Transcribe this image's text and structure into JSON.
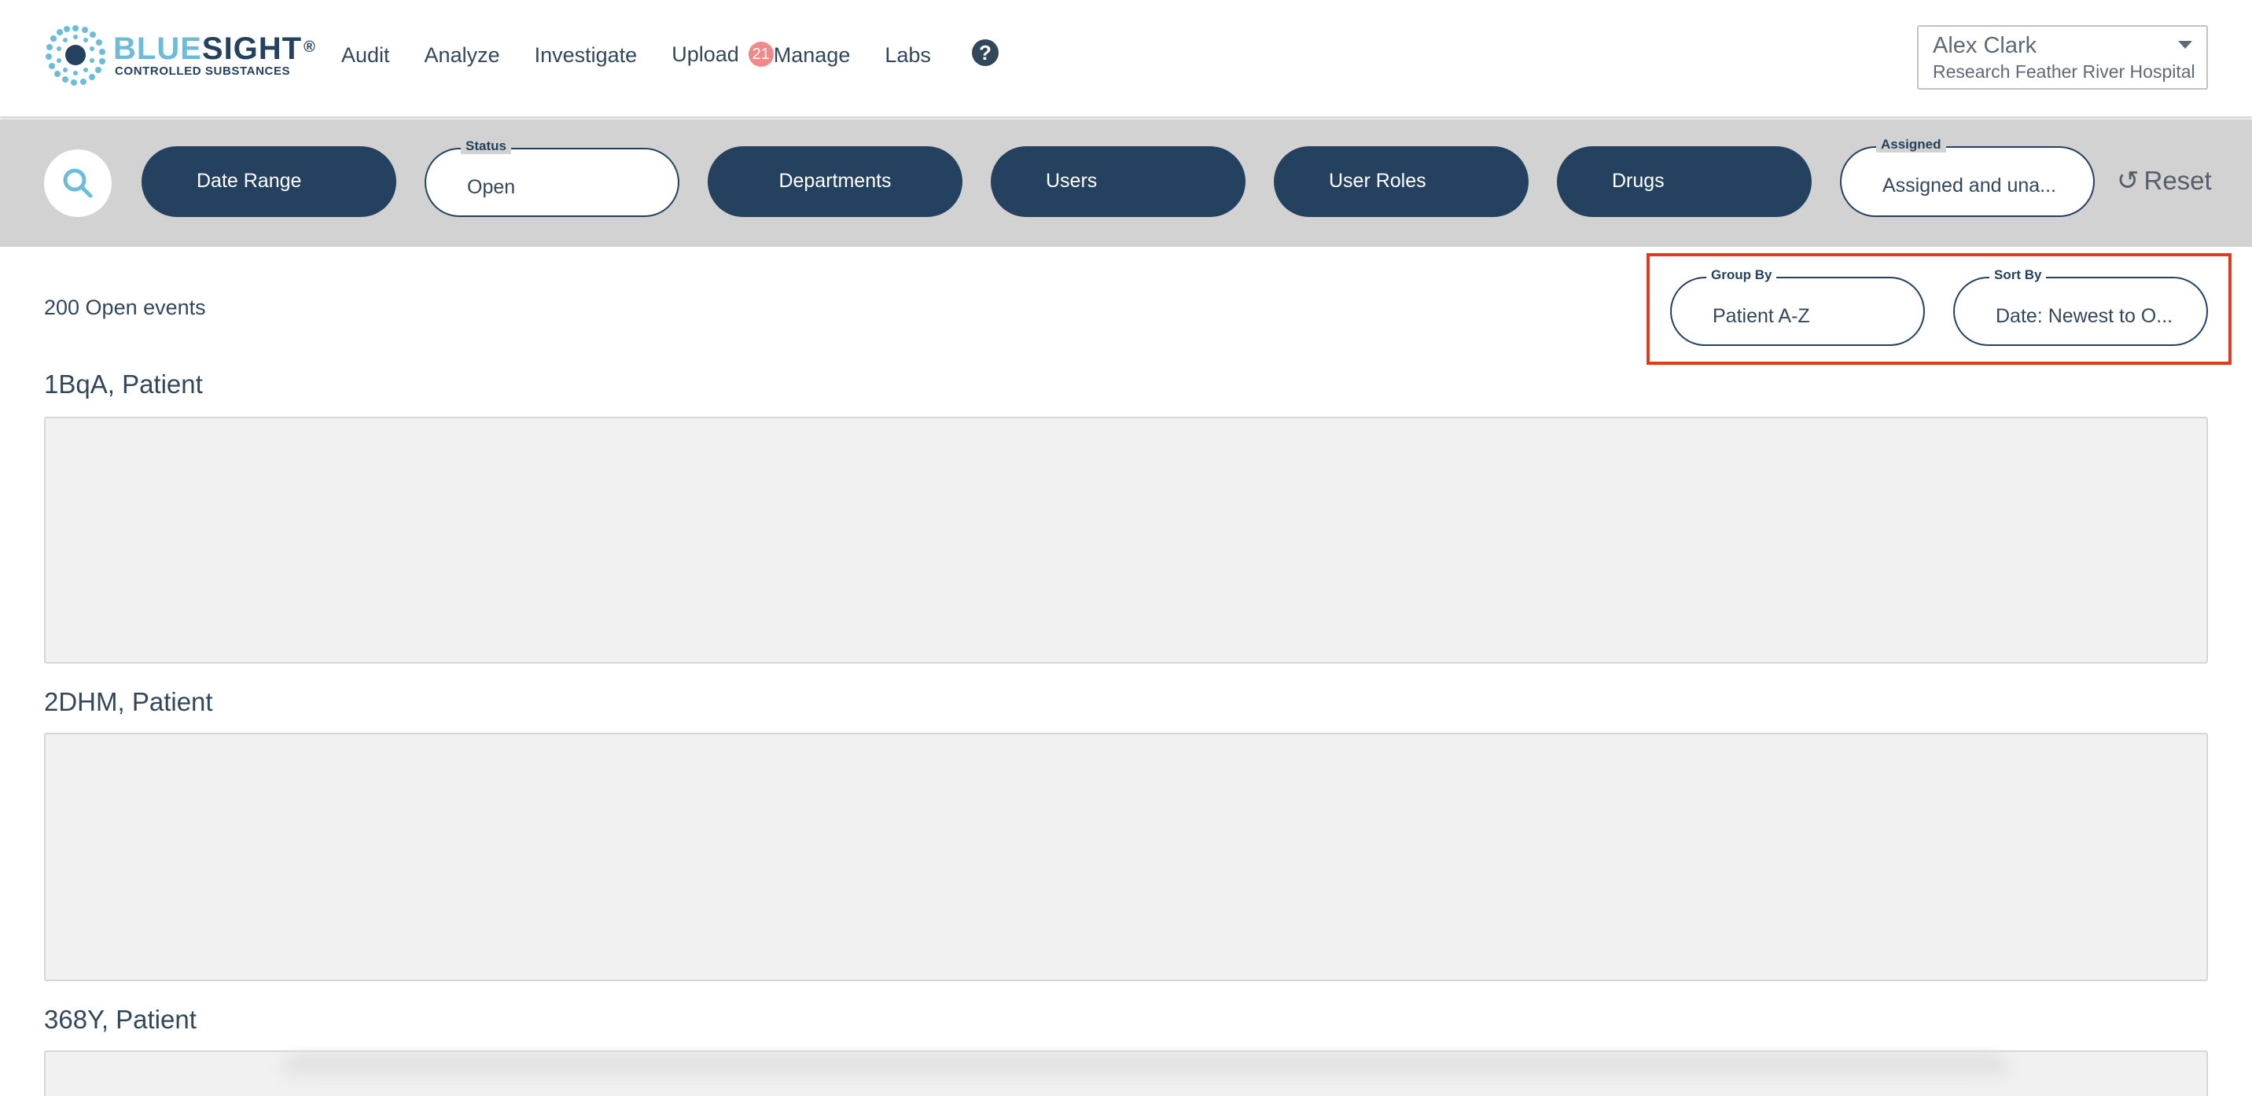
{
  "brand": {
    "word_light": "BLUE",
    "word_dark": "SIGHT",
    "registered": "®",
    "subtitle": "CONTROLLED SUBSTANCES",
    "colors": {
      "light": "#6cbcd9",
      "dark": "#24415f"
    }
  },
  "nav": {
    "items": [
      "Audit",
      "Analyze",
      "Investigate",
      "Upload",
      "Manage",
      "Labs"
    ],
    "upload_badge": "21",
    "help_icon": "question-circle-icon"
  },
  "user": {
    "name": "Alex Clark",
    "organization": "Research Feather River Hospital"
  },
  "filters": {
    "search_icon": "magnifier-icon",
    "date_range": "Date Range",
    "status": {
      "label": "Status",
      "value": "Open"
    },
    "departments": "Departments",
    "users": "Users",
    "user_roles": "User Roles",
    "drugs": "Drugs",
    "assigned": {
      "label": "Assigned",
      "value": "Assigned and una..."
    },
    "reset": "Reset"
  },
  "content": {
    "events_count": "200 Open events",
    "group_by": {
      "label": "Group By",
      "value": "Patient A-Z"
    },
    "sort_by": {
      "label": "Sort By",
      "value": "Date: Newest to O..."
    },
    "groups": [
      {
        "title": "1BqA, Patient"
      },
      {
        "title": "2DHM, Patient"
      },
      {
        "title": "368Y, Patient"
      }
    ]
  },
  "colors": {
    "navy": "#24415f",
    "filter_bar": "#d2d2d2",
    "badge": "#f08a8a",
    "highlight": "#e03b1f"
  }
}
